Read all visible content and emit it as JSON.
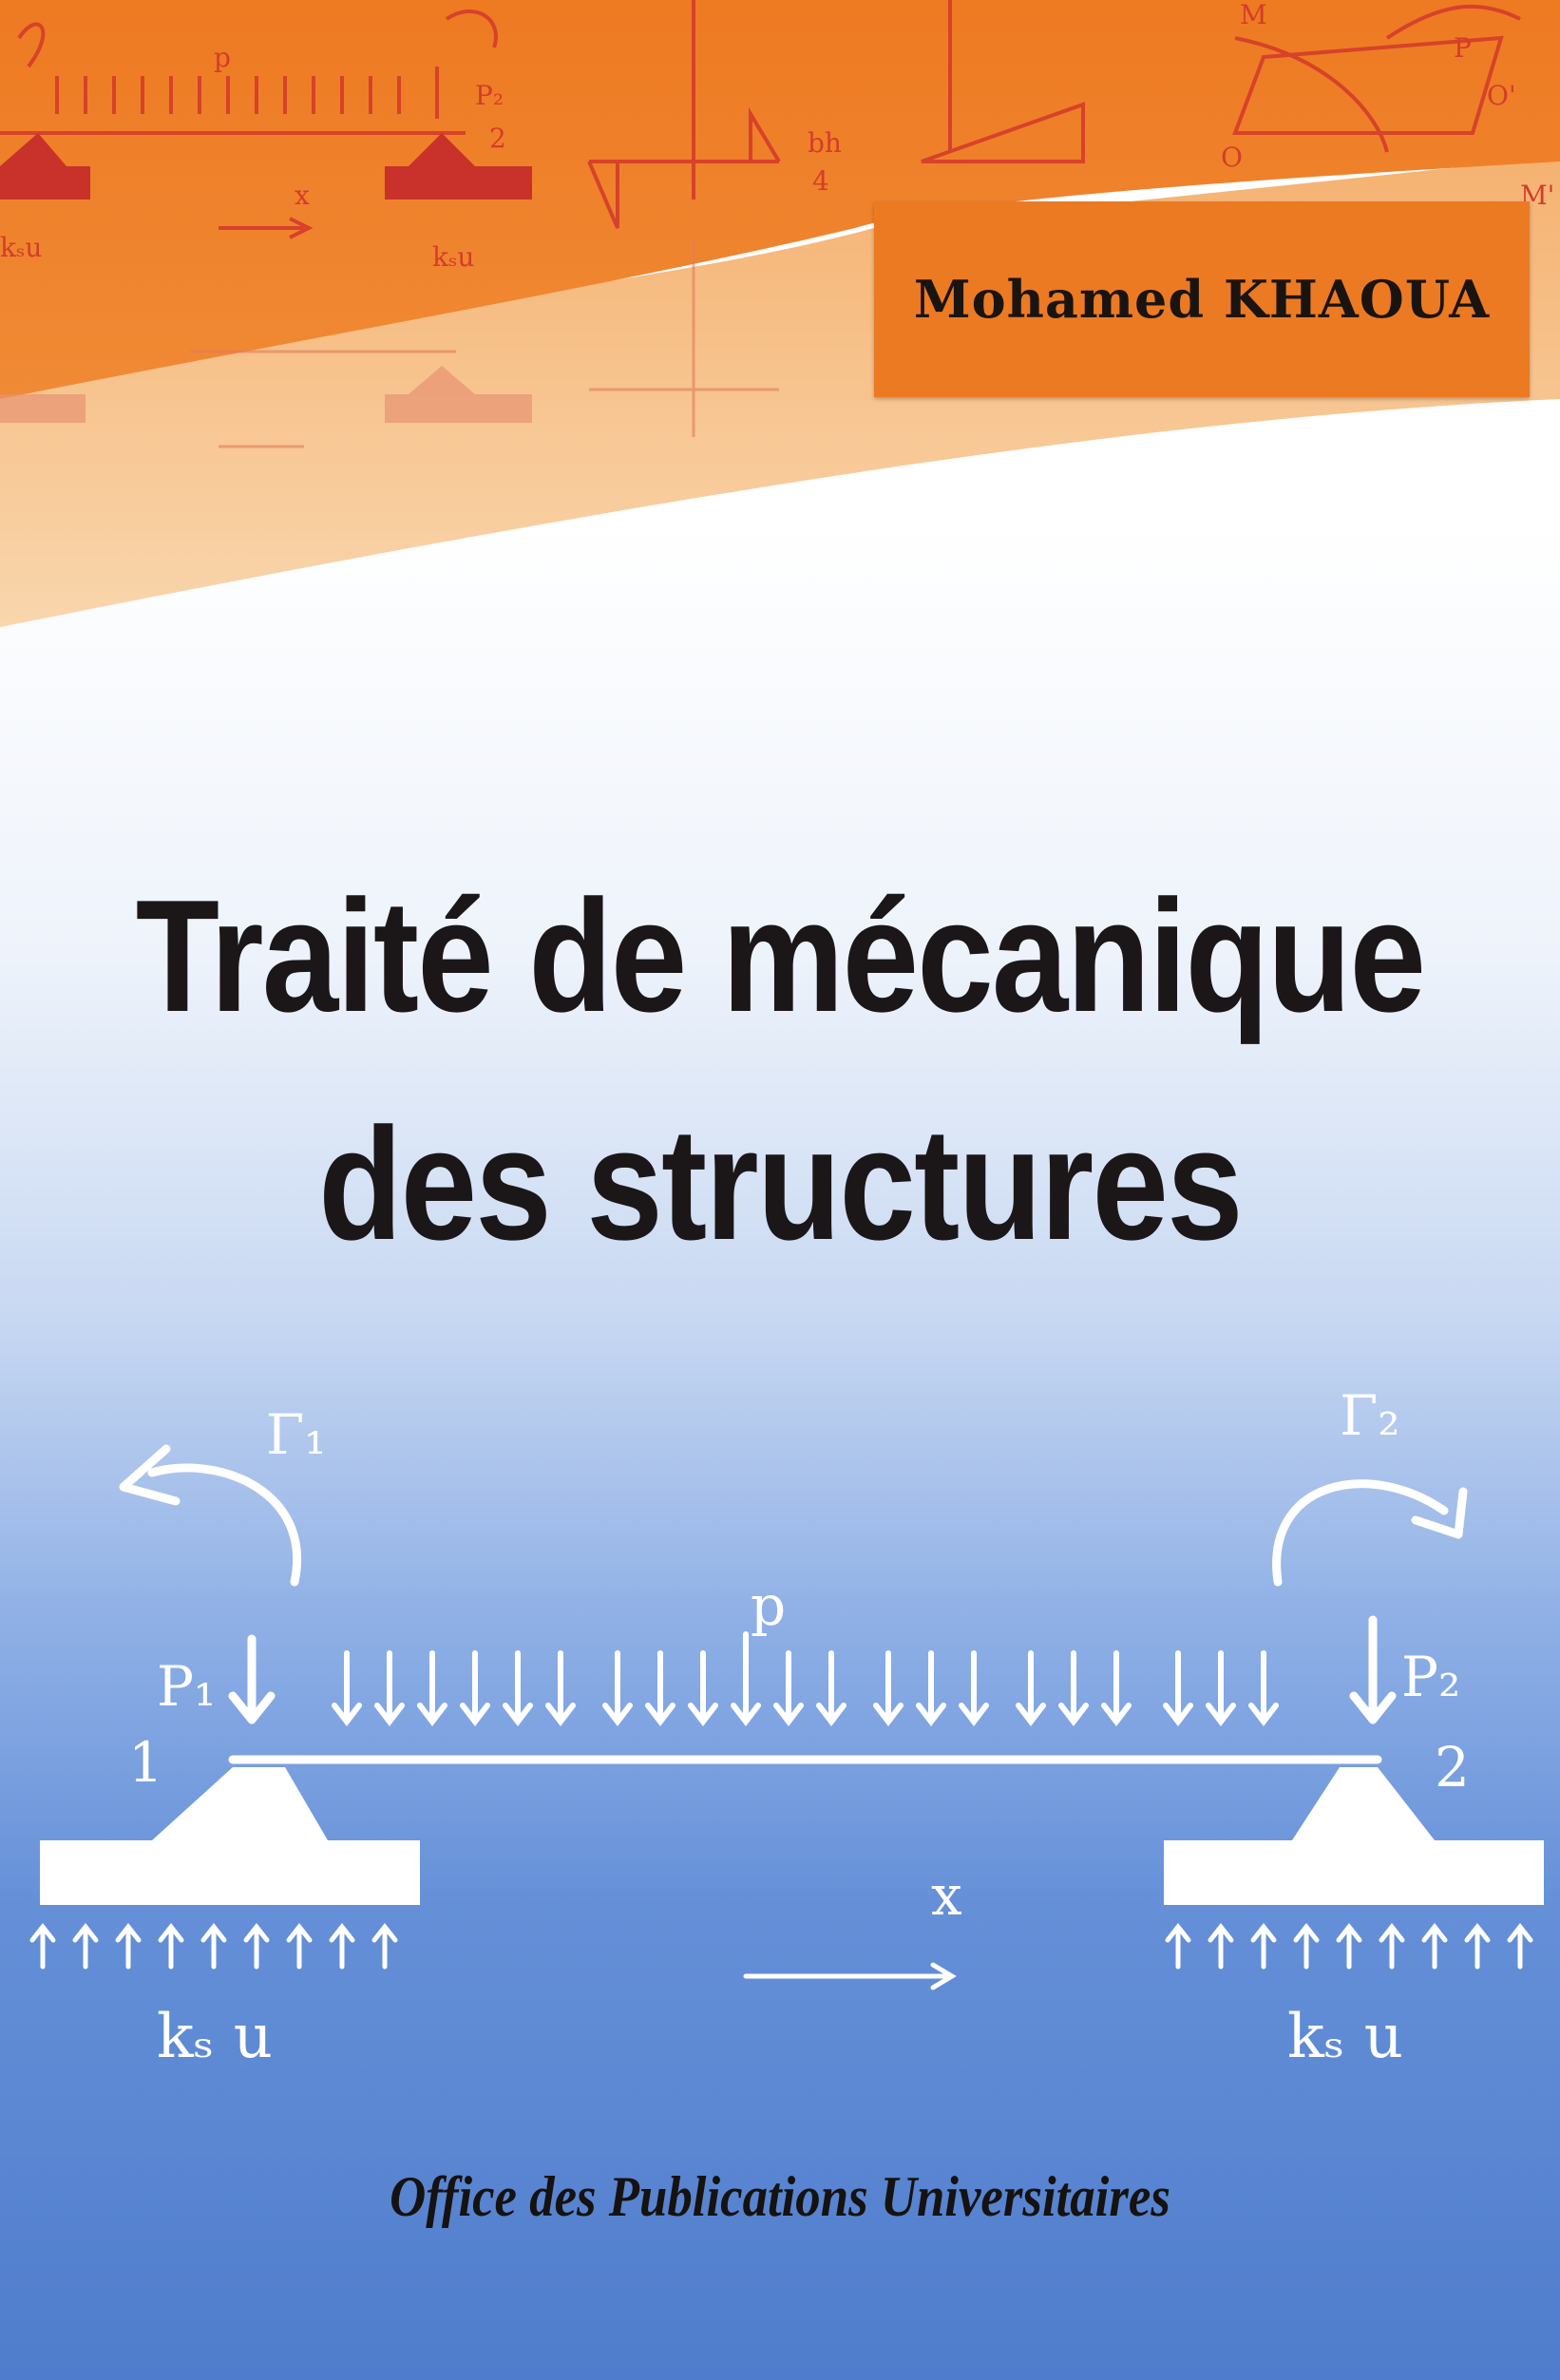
{
  "cover": {
    "author": "Mohamed KHAOUA",
    "title_line1": "Traité de mécanique",
    "title_line2": "des structures",
    "publisher": "Office des Publications Universitaires"
  },
  "diagram_labels": {
    "gamma1": "Γ₁",
    "gamma2": "Γ₂",
    "p": "p",
    "p1": "P₁",
    "p2": "P₂",
    "node1": "1",
    "node2": "2",
    "x": "x",
    "ksu_left": "kₛ u",
    "ksu_right": "kₛ u"
  },
  "header_labels": {
    "p": "p",
    "p2": "P₂",
    "node2": "2",
    "x": "x",
    "ksu_left": "kₛu",
    "ksu_right": "kₛu",
    "bh": "bh",
    "four": "4",
    "m": "M",
    "p_label": "P",
    "o_prime": "O'",
    "o": "O",
    "m_prime": "M'"
  },
  "colors": {
    "orange": "#ec7a23",
    "orange_light": "#f4a361",
    "red": "#d43c2b",
    "blue_bottom": "#4f7ccc"
  }
}
